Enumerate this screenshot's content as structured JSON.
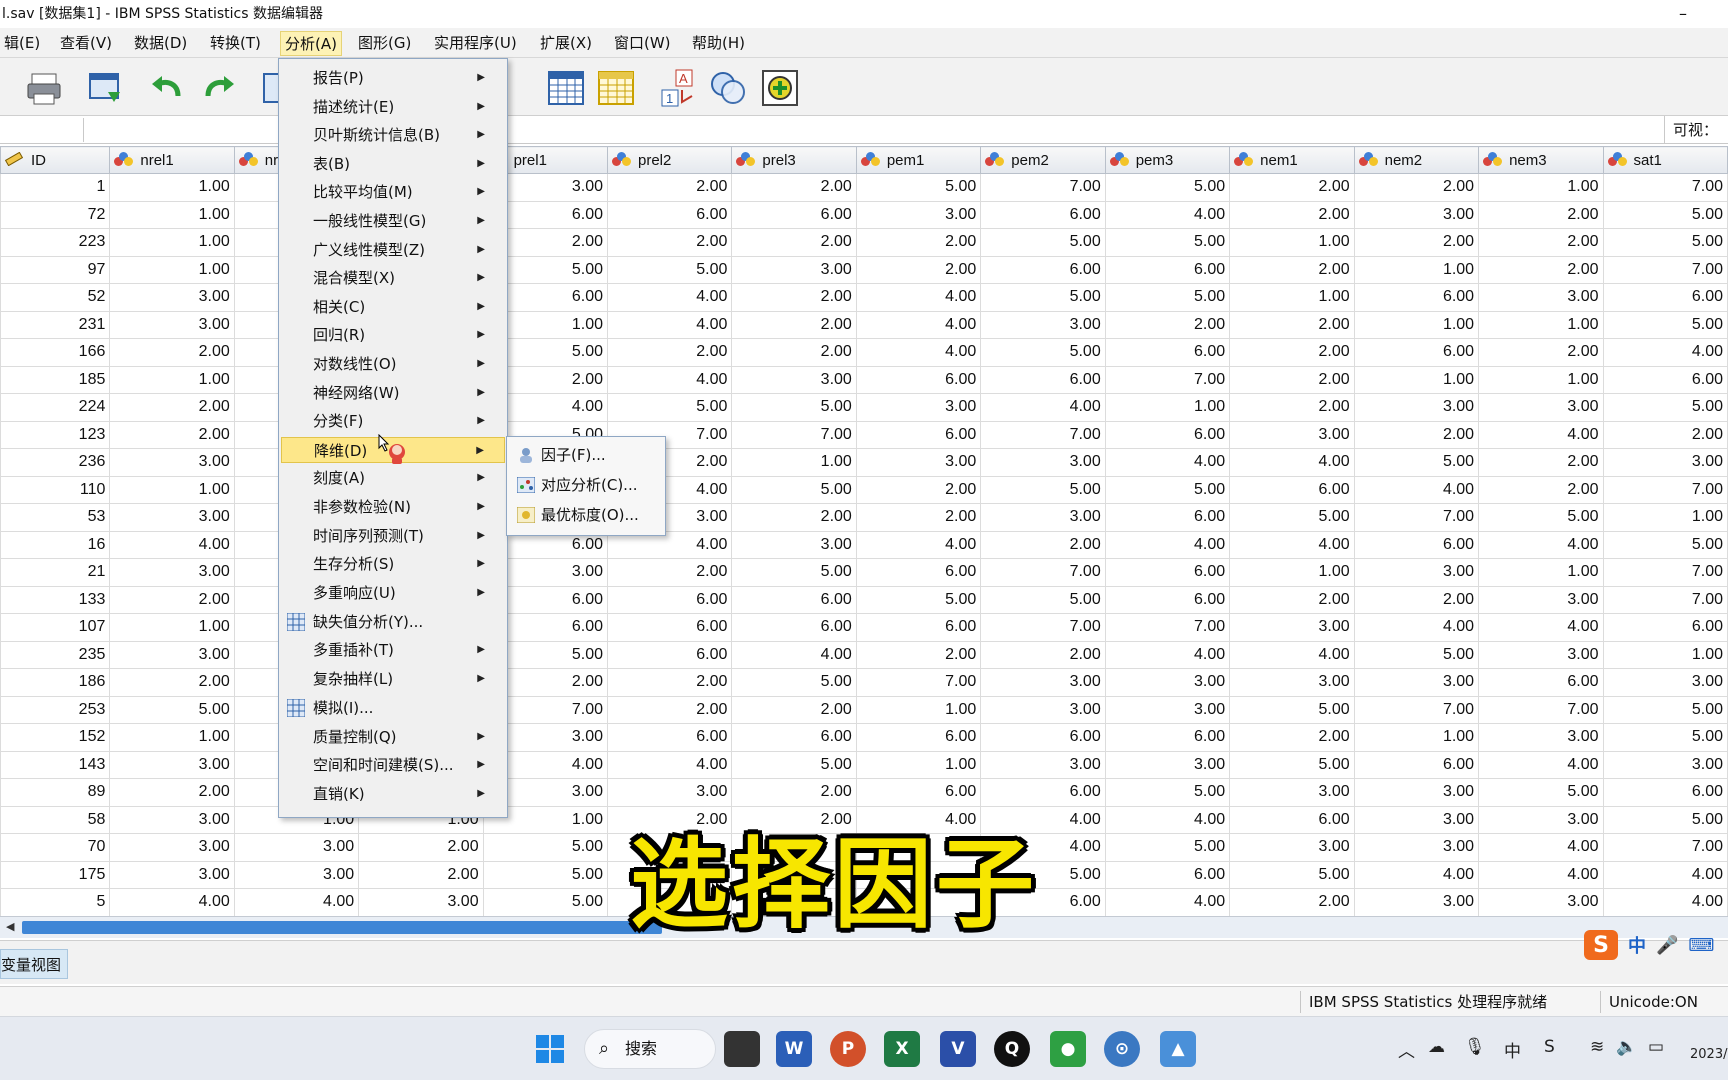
{
  "window": {
    "title": "l.sav [数据集1] - IBM SPSS Statistics 数据编辑器",
    "minimize": "–"
  },
  "menubar": [
    {
      "label": "辑(E)"
    },
    {
      "label": "查看(V)"
    },
    {
      "label": "数据(D)"
    },
    {
      "label": "转换(T)"
    },
    {
      "label": "分析(A)"
    },
    {
      "label": "图形(G)"
    },
    {
      "label": "实用程序(U)"
    },
    {
      "label": "扩展(X)"
    },
    {
      "label": "窗口(W)"
    },
    {
      "label": "帮助(H)"
    }
  ],
  "toolbar": {
    "icons": [
      "print-icon",
      "recall-dialog-icon",
      "undo-icon",
      "redo-icon",
      "go-to-case-icon",
      "variables-grid-icon",
      "data-grid-icon",
      "value-labels-icon",
      "use-sets-icon",
      "add-icon"
    ]
  },
  "name_row": {
    "visible_label": "可视："
  },
  "grid": {
    "columns": [
      "ID",
      "nrel1",
      "nrel2",
      "nrel3",
      "prel1",
      "prel2",
      "prel3",
      "pem1",
      "pem2",
      "pem3",
      "nem1",
      "nem2",
      "nem3",
      "sat1"
    ],
    "rows": [
      [
        "1",
        "1.00",
        "",
        "",
        "3.00",
        "2.00",
        "2.00",
        "5.00",
        "7.00",
        "5.00",
        "2.00",
        "2.00",
        "1.00",
        "7.00"
      ],
      [
        "72",
        "1.00",
        "",
        "",
        "6.00",
        "6.00",
        "6.00",
        "3.00",
        "6.00",
        "4.00",
        "2.00",
        "3.00",
        "2.00",
        "5.00"
      ],
      [
        "223",
        "1.00",
        "",
        "",
        "2.00",
        "2.00",
        "2.00",
        "2.00",
        "5.00",
        "5.00",
        "1.00",
        "2.00",
        "2.00",
        "5.00"
      ],
      [
        "97",
        "1.00",
        "",
        "",
        "5.00",
        "5.00",
        "3.00",
        "2.00",
        "6.00",
        "6.00",
        "2.00",
        "1.00",
        "2.00",
        "7.00"
      ],
      [
        "52",
        "3.00",
        "",
        "",
        "6.00",
        "4.00",
        "2.00",
        "4.00",
        "5.00",
        "5.00",
        "1.00",
        "6.00",
        "3.00",
        "6.00"
      ],
      [
        "231",
        "3.00",
        "",
        "",
        "1.00",
        "4.00",
        "2.00",
        "4.00",
        "3.00",
        "2.00",
        "2.00",
        "1.00",
        "1.00",
        "5.00"
      ],
      [
        "166",
        "2.00",
        "",
        "",
        "5.00",
        "2.00",
        "2.00",
        "4.00",
        "5.00",
        "6.00",
        "2.00",
        "6.00",
        "2.00",
        "4.00"
      ],
      [
        "185",
        "1.00",
        "",
        "",
        "2.00",
        "4.00",
        "3.00",
        "6.00",
        "6.00",
        "7.00",
        "2.00",
        "1.00",
        "1.00",
        "6.00"
      ],
      [
        "224",
        "2.00",
        "",
        "",
        "4.00",
        "5.00",
        "5.00",
        "3.00",
        "4.00",
        "1.00",
        "2.00",
        "3.00",
        "3.00",
        "5.00"
      ],
      [
        "123",
        "2.00",
        "",
        "",
        "5.00",
        "7.00",
        "7.00",
        "6.00",
        "7.00",
        "6.00",
        "3.00",
        "2.00",
        "4.00",
        "2.00"
      ],
      [
        "236",
        "3.00",
        "",
        "",
        "",
        "2.00",
        "1.00",
        "3.00",
        "3.00",
        "4.00",
        "4.00",
        "5.00",
        "2.00",
        "3.00"
      ],
      [
        "110",
        "1.00",
        "",
        "",
        "",
        "4.00",
        "5.00",
        "2.00",
        "5.00",
        "5.00",
        "6.00",
        "4.00",
        "2.00",
        "7.00"
      ],
      [
        "53",
        "3.00",
        "",
        "",
        "",
        "3.00",
        "2.00",
        "2.00",
        "3.00",
        "6.00",
        "5.00",
        "7.00",
        "5.00",
        "1.00"
      ],
      [
        "16",
        "4.00",
        "",
        "",
        "6.00",
        "4.00",
        "3.00",
        "4.00",
        "2.00",
        "4.00",
        "4.00",
        "6.00",
        "4.00",
        "5.00"
      ],
      [
        "21",
        "3.00",
        "",
        "",
        "3.00",
        "2.00",
        "5.00",
        "6.00",
        "7.00",
        "6.00",
        "1.00",
        "3.00",
        "1.00",
        "7.00"
      ],
      [
        "133",
        "2.00",
        "",
        "",
        "6.00",
        "6.00",
        "6.00",
        "5.00",
        "5.00",
        "6.00",
        "2.00",
        "2.00",
        "3.00",
        "7.00"
      ],
      [
        "107",
        "1.00",
        "",
        "",
        "6.00",
        "6.00",
        "6.00",
        "6.00",
        "7.00",
        "7.00",
        "3.00",
        "4.00",
        "4.00",
        "6.00"
      ],
      [
        "235",
        "3.00",
        "",
        "",
        "5.00",
        "6.00",
        "4.00",
        "2.00",
        "2.00",
        "4.00",
        "4.00",
        "5.00",
        "3.00",
        "1.00"
      ],
      [
        "186",
        "2.00",
        "",
        "",
        "2.00",
        "2.00",
        "5.00",
        "7.00",
        "3.00",
        "3.00",
        "3.00",
        "3.00",
        "6.00",
        "3.00"
      ],
      [
        "253",
        "5.00",
        "",
        "",
        "7.00",
        "2.00",
        "2.00",
        "1.00",
        "3.00",
        "3.00",
        "5.00",
        "7.00",
        "7.00",
        "5.00"
      ],
      [
        "152",
        "1.00",
        "",
        "",
        "3.00",
        "6.00",
        "6.00",
        "6.00",
        "6.00",
        "6.00",
        "2.00",
        "1.00",
        "3.00",
        "5.00"
      ],
      [
        "143",
        "3.00",
        "",
        "",
        "4.00",
        "4.00",
        "5.00",
        "1.00",
        "3.00",
        "3.00",
        "5.00",
        "6.00",
        "4.00",
        "3.00"
      ],
      [
        "89",
        "2.00",
        "",
        "",
        "3.00",
        "3.00",
        "2.00",
        "6.00",
        "6.00",
        "5.00",
        "3.00",
        "3.00",
        "5.00",
        "6.00"
      ],
      [
        "58",
        "3.00",
        "1.00",
        "1.00",
        "1.00",
        "2.00",
        "2.00",
        "4.00",
        "4.00",
        "4.00",
        "6.00",
        "3.00",
        "3.00",
        "5.00"
      ],
      [
        "70",
        "3.00",
        "3.00",
        "2.00",
        "5.00",
        "",
        "",
        "",
        "4.00",
        "5.00",
        "3.00",
        "3.00",
        "4.00",
        "7.00"
      ],
      [
        "175",
        "3.00",
        "3.00",
        "2.00",
        "5.00",
        "",
        "",
        "",
        "5.00",
        "6.00",
        "5.00",
        "4.00",
        "4.00",
        "4.00"
      ],
      [
        "5",
        "4.00",
        "4.00",
        "3.00",
        "5.00",
        "",
        "",
        "",
        "6.00",
        "4.00",
        "2.00",
        "3.00",
        "3.00",
        "4.00"
      ]
    ]
  },
  "analyze_menu": {
    "items": [
      {
        "label": "报告(P)",
        "sub": true
      },
      {
        "label": "描述统计(E)",
        "sub": true
      },
      {
        "label": "贝叶斯统计信息(B)",
        "sub": true
      },
      {
        "label": "表(B)",
        "sub": true
      },
      {
        "label": "比较平均值(M)",
        "sub": true
      },
      {
        "label": "一般线性模型(G)",
        "sub": true
      },
      {
        "label": "广义线性模型(Z)",
        "sub": true
      },
      {
        "label": "混合模型(X)",
        "sub": true
      },
      {
        "label": "相关(C)",
        "sub": true
      },
      {
        "label": "回归(R)",
        "sub": true
      },
      {
        "label": "对数线性(O)",
        "sub": true
      },
      {
        "label": "神经网络(W)",
        "sub": true
      },
      {
        "label": "分类(F)",
        "sub": true
      },
      {
        "label": "降维(D)",
        "sub": true
      },
      {
        "label": "刻度(A)",
        "sub": true
      },
      {
        "label": "非参数检验(N)",
        "sub": true
      },
      {
        "label": "时间序列预测(T)",
        "sub": true
      },
      {
        "label": "生存分析(S)",
        "sub": true
      },
      {
        "label": "多重响应(U)",
        "sub": true
      },
      {
        "label": "缺失值分析(Y)...",
        "sub": false
      },
      {
        "label": "多重插补(T)",
        "sub": true
      },
      {
        "label": "复杂抽样(L)",
        "sub": true
      },
      {
        "label": "模拟(I)...",
        "sub": false
      },
      {
        "label": "质量控制(Q)",
        "sub": true
      },
      {
        "label": "空间和时间建模(S)...",
        "sub": true
      },
      {
        "label": "直销(K)",
        "sub": true
      }
    ],
    "highlighted": "降维(D)"
  },
  "submenu": {
    "items": [
      {
        "label": "因子(F)..."
      },
      {
        "label": "对应分析(C)..."
      },
      {
        "label": "最优标度(O)..."
      }
    ]
  },
  "tabs": {
    "variable_view": "变量视图"
  },
  "statusbar": {
    "processor": "IBM SPSS Statistics 处理程序就绪",
    "unicode": "Unicode:ON"
  },
  "caption": "选择因子",
  "ime": {
    "logo": "S",
    "lang": "中"
  },
  "taskbar": {
    "search": "搜索",
    "clock": "2023/"
  }
}
